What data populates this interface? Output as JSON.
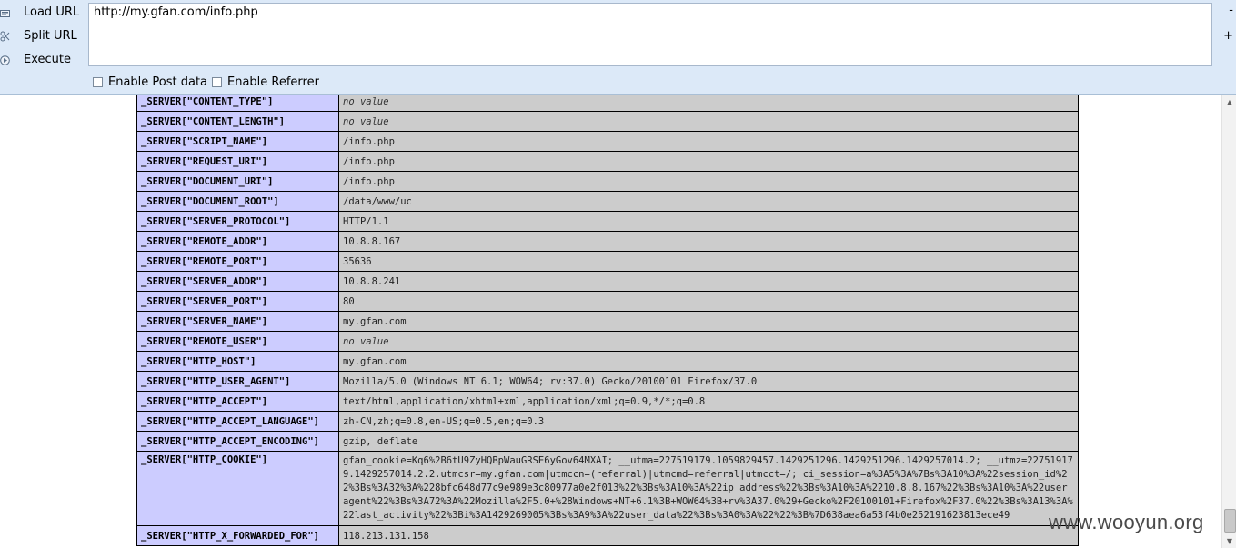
{
  "hackbar": {
    "actions": [
      {
        "label": "Load URL",
        "icon": "load-url-icon"
      },
      {
        "label": "Split URL",
        "icon": "split-url-icon"
      },
      {
        "label": "Execute",
        "icon": "execute-icon"
      }
    ],
    "url_value": "http://my.gfan.com/info.php",
    "side_buttons": {
      "decrease": "-",
      "increase": "+"
    },
    "options": {
      "post_data_label": "Enable Post data",
      "referrer_label": "Enable Referrer"
    }
  },
  "phpinfo": {
    "rows": [
      {
        "key": "_SERVER[\"CONTENT_TYPE\"]",
        "value": "no value",
        "novalue": true
      },
      {
        "key": "_SERVER[\"CONTENT_LENGTH\"]",
        "value": "no value",
        "novalue": true
      },
      {
        "key": "_SERVER[\"SCRIPT_NAME\"]",
        "value": "/info.php"
      },
      {
        "key": "_SERVER[\"REQUEST_URI\"]",
        "value": "/info.php"
      },
      {
        "key": "_SERVER[\"DOCUMENT_URI\"]",
        "value": "/info.php"
      },
      {
        "key": "_SERVER[\"DOCUMENT_ROOT\"]",
        "value": "/data/www/uc"
      },
      {
        "key": "_SERVER[\"SERVER_PROTOCOL\"]",
        "value": "HTTP/1.1"
      },
      {
        "key": "_SERVER[\"REMOTE_ADDR\"]",
        "value": "10.8.8.167"
      },
      {
        "key": "_SERVER[\"REMOTE_PORT\"]",
        "value": "35636"
      },
      {
        "key": "_SERVER[\"SERVER_ADDR\"]",
        "value": "10.8.8.241"
      },
      {
        "key": "_SERVER[\"SERVER_PORT\"]",
        "value": "80"
      },
      {
        "key": "_SERVER[\"SERVER_NAME\"]",
        "value": "my.gfan.com"
      },
      {
        "key": "_SERVER[\"REMOTE_USER\"]",
        "value": "no value",
        "novalue": true
      },
      {
        "key": "_SERVER[\"HTTP_HOST\"]",
        "value": "my.gfan.com"
      },
      {
        "key": "_SERVER[\"HTTP_USER_AGENT\"]",
        "value": "Mozilla/5.0 (Windows NT 6.1; WOW64; rv:37.0) Gecko/20100101 Firefox/37.0"
      },
      {
        "key": "_SERVER[\"HTTP_ACCEPT\"]",
        "value": "text/html,application/xhtml+xml,application/xml;q=0.9,*/*;q=0.8"
      },
      {
        "key": "_SERVER[\"HTTP_ACCEPT_LANGUAGE\"]",
        "value": "zh-CN,zh;q=0.8,en-US;q=0.5,en;q=0.3"
      },
      {
        "key": "_SERVER[\"HTTP_ACCEPT_ENCODING\"]",
        "value": "gzip, deflate"
      },
      {
        "key": "_SERVER[\"HTTP_COOKIE\"]",
        "value": "gfan_cookie=Kq6%2B6tU9ZyHQBpWauGRSE6yGov64MXAI; __utma=227519179.1059829457.1429251296.1429251296.1429257014.2; __utmz=227519179.1429257014.2.2.utmcsr=my.gfan.com|utmccn=(referral)|utmcmd=referral|utmcct=/; ci_session=a%3A5%3A%7Bs%3A10%3A%22session_id%22%3Bs%3A32%3A%228bfc648d77c9e989e3c80977a0e2f013%22%3Bs%3A10%3A%22ip_address%22%3Bs%3A10%3A%2210.8.8.167%22%3Bs%3A10%3A%22user_agent%22%3Bs%3A72%3A%22Mozilla%2F5.0+%28Windows+NT+6.1%3B+WOW64%3B+rv%3A37.0%29+Gecko%2F20100101+Firefox%2F37.0%22%3Bs%3A13%3A%22last_activity%22%3Bi%3A1429269005%3Bs%3A9%3A%22user_data%22%3Bs%3A0%3A%22%22%3B%7D638aea6a53f4b0e252191623813ece49",
        "tall": true
      },
      {
        "key": "_SERVER[\"HTTP_X_FORWARDED_FOR\"]",
        "value": "118.213.131.158"
      }
    ]
  },
  "watermark": "www.wooyun.org",
  "colors": {
    "toolbar_bg": "#dce9f8",
    "key_cell_bg": "#ccccff",
    "value_cell_bg": "#cccccc"
  }
}
